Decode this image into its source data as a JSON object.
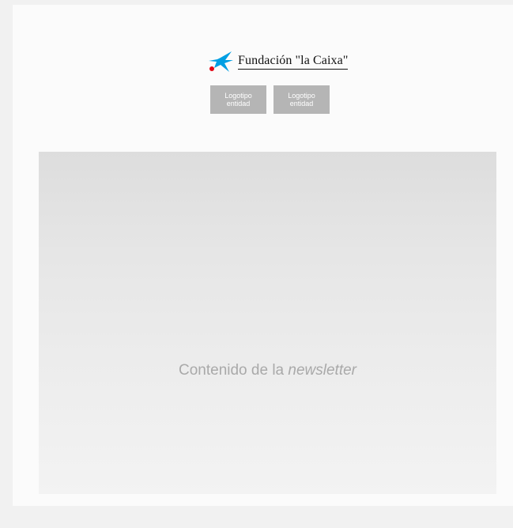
{
  "brand": {
    "name": "Fundación \"la Caixa\"",
    "colors": {
      "star": "#009fe3",
      "dot": "#e30613"
    },
    "icon": "caixa-star-logo"
  },
  "partner_logos": [
    {
      "line1": "Logotipo",
      "line2": "entidad"
    },
    {
      "line1": "Logotipo",
      "line2": "entidad"
    }
  ],
  "content": {
    "text_prefix": "Contenido de la ",
    "text_emphasis": "newsletter"
  },
  "colors": {
    "page_background": "#f1f1f1",
    "card_background": "#fbfbfb",
    "placeholder_box": "#b5b5b5",
    "content_text": "#a9a9a9"
  }
}
